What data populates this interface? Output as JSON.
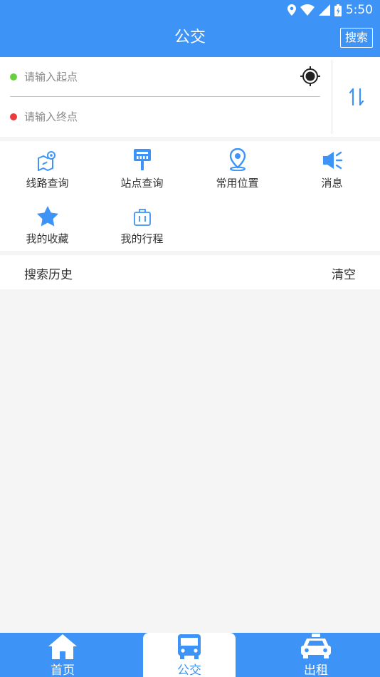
{
  "status_bar": {
    "time": "5:50"
  },
  "app_bar": {
    "title": "公交",
    "search_label": "搜索"
  },
  "route": {
    "start_placeholder": "请输入起点",
    "end_placeholder": "请输入终点"
  },
  "menu": {
    "items": [
      {
        "label": "线路查询",
        "icon": "route-map-icon"
      },
      {
        "label": "站点查询",
        "icon": "bus-stop-sign-icon"
      },
      {
        "label": "常用位置",
        "icon": "location-pin-icon"
      },
      {
        "label": "消息",
        "icon": "megaphone-icon"
      },
      {
        "label": "我的收藏",
        "icon": "star-icon"
      },
      {
        "label": "我的行程",
        "icon": "suitcase-icon"
      }
    ]
  },
  "history": {
    "title": "搜索历史",
    "clear_label": "清空"
  },
  "tabs": [
    {
      "label": "首页",
      "icon": "home-icon"
    },
    {
      "label": "公交",
      "icon": "bus-icon"
    },
    {
      "label": "出租",
      "icon": "taxi-icon"
    }
  ],
  "colors": {
    "primary": "#3d94f6",
    "start_dot": "#66d13c",
    "end_dot": "#ea3c3c",
    "background": "#f5f5f5"
  }
}
